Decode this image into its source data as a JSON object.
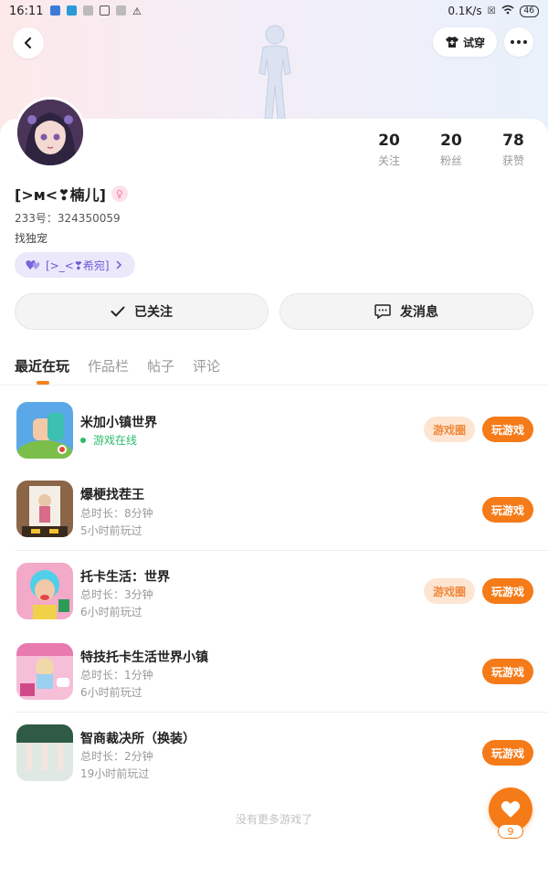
{
  "status_bar": {
    "time": "16:11",
    "network_speed": "0.1K/s",
    "battery": "46"
  },
  "header": {
    "try_on_label": "试穿"
  },
  "profile": {
    "username": "[>ᴍ<❣楠儿]",
    "gender_symbol": "♀",
    "id_label": "233号：324350059",
    "bio": "找独宠",
    "couple_tag": "[>_<❣希宛]",
    "stats": [
      {
        "num": "20",
        "label": "关注"
      },
      {
        "num": "20",
        "label": "粉丝"
      },
      {
        "num": "78",
        "label": "获赞"
      }
    ]
  },
  "actions": {
    "follow_label": "已关注",
    "message_label": "发消息"
  },
  "tabs": [
    {
      "label": "最近在玩",
      "active": true
    },
    {
      "label": "作品栏",
      "active": false
    },
    {
      "label": "帖子",
      "active": false
    },
    {
      "label": "评论",
      "active": false
    }
  ],
  "games": [
    {
      "title": "米加小镇世界",
      "status": "游戏在线",
      "has_circle": true
    },
    {
      "title": "爆梗找茬王",
      "duration": "总时长：8分钟",
      "last_played": "5小时前玩过",
      "has_circle": false
    },
    {
      "title": "托卡生活：世界",
      "duration": "总时长：3分钟",
      "last_played": "6小时前玩过",
      "has_circle": true
    },
    {
      "title": "特技托卡生活世界小镇",
      "duration": "总时长：1分钟",
      "last_played": "6小时前玩过",
      "has_circle": false
    },
    {
      "title": "智商裁决所（换装）",
      "duration": "总时长：2分钟",
      "last_played": "19小时前玩过",
      "has_circle": false
    }
  ],
  "play_label": "玩游戏",
  "circle_label": "游戏圈",
  "footer": {
    "no_more": "没有更多游戏了",
    "like_count": "9"
  },
  "colors": {
    "accent": "#f57a18",
    "online": "#2dbb6a"
  }
}
